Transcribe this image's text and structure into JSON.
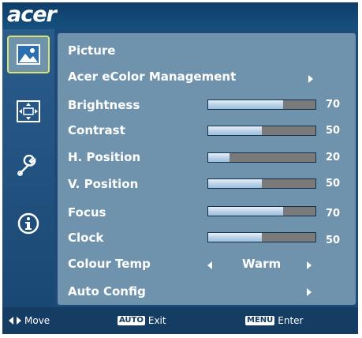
{
  "brand": {
    "logo_text": "acer"
  },
  "tabs": [
    {
      "icon": "picture-icon",
      "active": true
    },
    {
      "icon": "position-icon",
      "active": false
    },
    {
      "icon": "settings-wrench-icon",
      "active": false
    },
    {
      "icon": "info-icon",
      "active": false
    }
  ],
  "menu": {
    "section_title": "Picture",
    "ecolor_label": "Acer eColor Management",
    "sliders": [
      {
        "label": "Brightness",
        "value": "70",
        "level": 70
      },
      {
        "label": "Contrast",
        "value": "50",
        "level": 50
      },
      {
        "label": "H. Position",
        "value": "20",
        "level": 20
      },
      {
        "label": "V. Position",
        "value": "50",
        "level": 50
      },
      {
        "label": "Focus",
        "value": "70",
        "level": 70
      },
      {
        "label": "Clock",
        "value": "50",
        "level": 50
      }
    ],
    "colour_temp": {
      "label": "Colour Temp",
      "value": "Warm"
    },
    "auto_config_label": "Auto Config"
  },
  "footer": {
    "move_label": "Move",
    "auto_key": "AUTO",
    "exit_label": "Exit",
    "menu_key": "MENU",
    "enter_label": "Enter"
  },
  "colors": {
    "background": "#1d4a78",
    "panel": "#6f93ad",
    "active_outline": "#d9e36d"
  }
}
